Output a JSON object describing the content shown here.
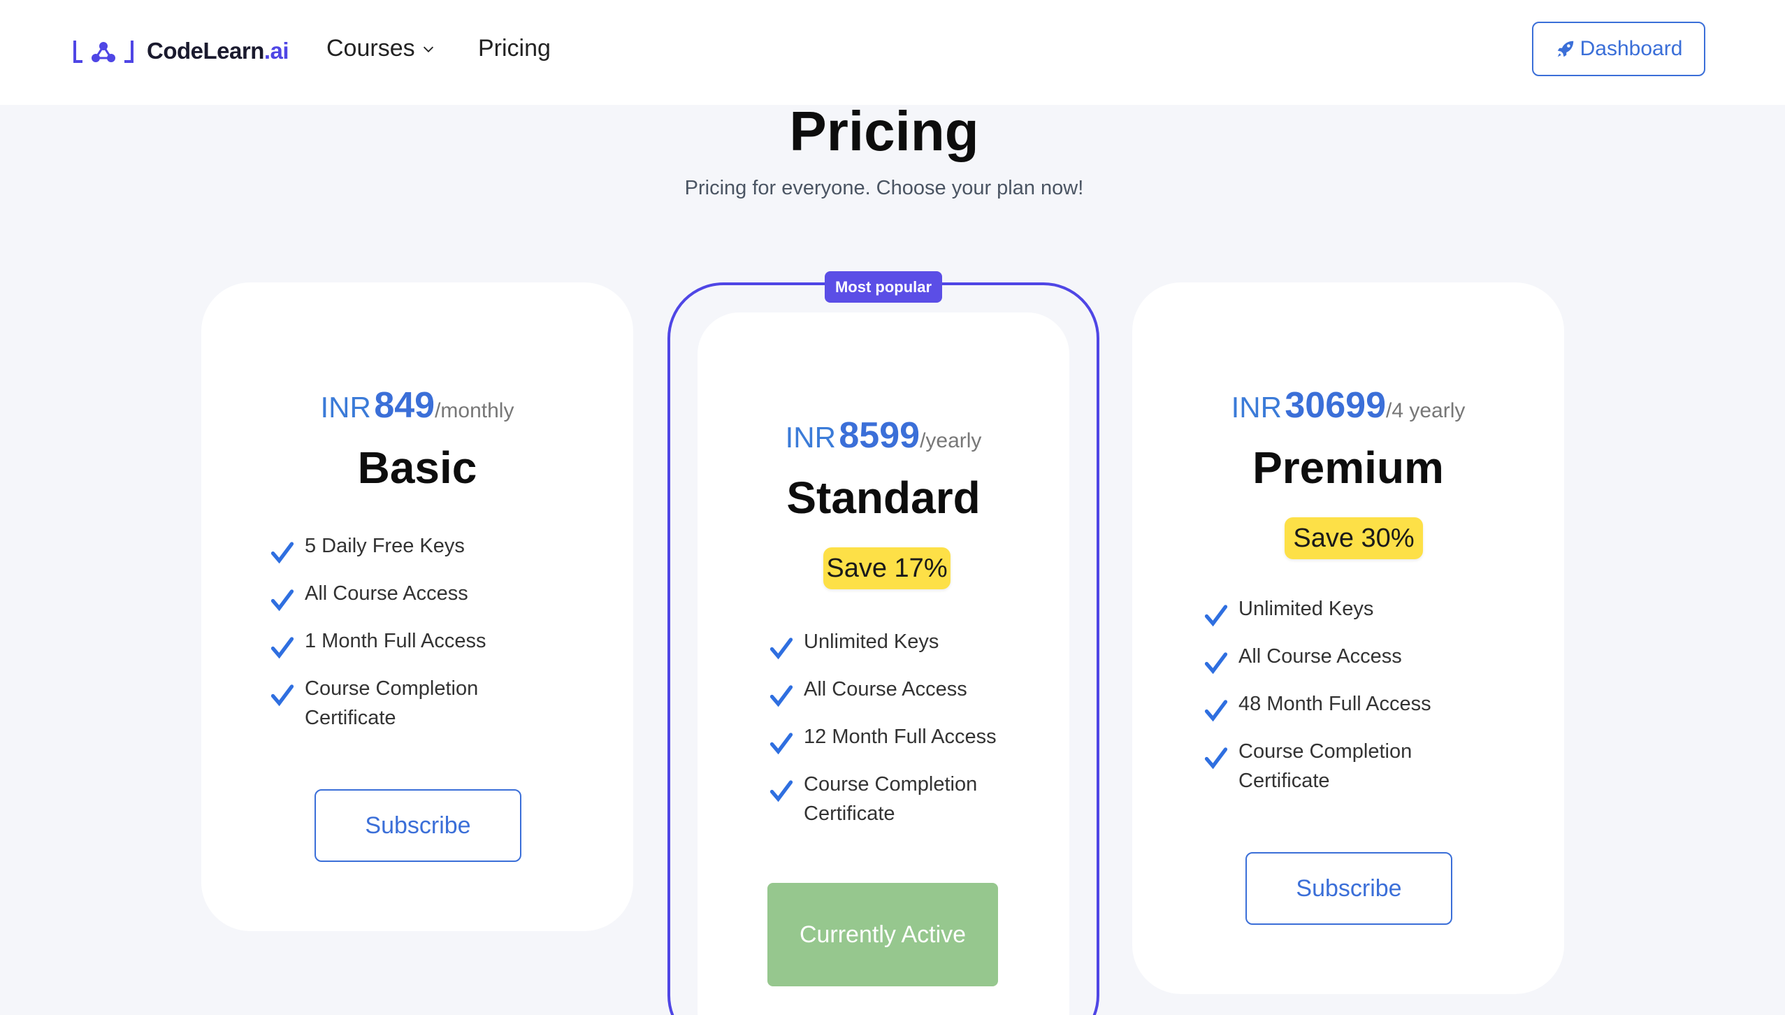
{
  "header": {
    "logo": {
      "brand": "CodeLearn",
      "brand_suffix": ".ai"
    },
    "nav": {
      "courses": "Courses",
      "pricing": "Pricing"
    },
    "dashboard_label": "Dashboard"
  },
  "page": {
    "title": "Pricing",
    "subtitle": "Pricing for everyone. Choose your plan now!"
  },
  "plans": [
    {
      "currency": "INR",
      "amount": "849",
      "period": "/monthly",
      "name": "Basic",
      "features": [
        "5 Daily Free Keys",
        "All Course Access",
        "1 Month Full Access",
        "Course Completion Certificate"
      ],
      "button": "Subscribe"
    },
    {
      "badge": "Most popular",
      "currency": "INR",
      "amount": "8599",
      "period": "/yearly",
      "name": "Standard",
      "save": "Save 17%",
      "features": [
        "Unlimited Keys",
        "All Course Access",
        "12 Month Full Access",
        "Course Completion Certificate"
      ],
      "button": "Currently Active"
    },
    {
      "currency": "INR",
      "amount": "30699",
      "period": "/4 yearly",
      "name": "Premium",
      "save": "Save 30%",
      "features": [
        "Unlimited Keys",
        "All Course Access",
        "48 Month Full Access",
        "Course Completion Certificate"
      ],
      "button": "Subscribe"
    }
  ],
  "colors": {
    "accent": "#3b6fd8",
    "popular_outline": "#4f46e5",
    "save_badge": "#fde047",
    "active_button": "#96c78e",
    "background": "#f5f6fa"
  },
  "icons": [
    "logo-icon",
    "chevron-down-icon",
    "rocket-icon",
    "check-icon"
  ]
}
